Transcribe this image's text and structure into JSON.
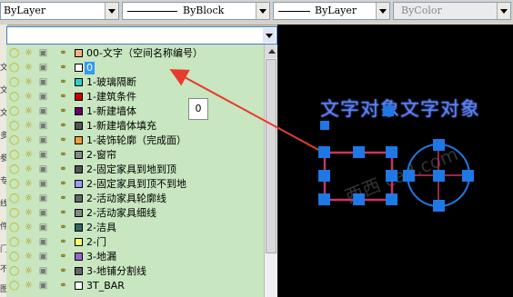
{
  "toolbar": {
    "color_value": "ByLayer",
    "linetype_value": "ByBlock",
    "lineweight_value": "ByLayer",
    "plotstyle_value": "ByColor"
  },
  "layer_combo": {
    "value": ""
  },
  "layer_tools": [
    {
      "icon": "make-current-icon"
    },
    {
      "icon": "layer-previous-icon"
    },
    {
      "icon": "layer-state-icon"
    }
  ],
  "left_strip_chars": [
    "文",
    "文",
    "文",
    "多",
    "参",
    "专",
    "线",
    "件",
    "门",
    "不",
    "图"
  ],
  "layers": [
    {
      "name": "00-文字（空间名称编号）",
      "color": "#f4b183"
    },
    {
      "name": "0",
      "color": "#ffffff",
      "selected": true
    },
    {
      "name": "1-玻璃隔断",
      "color": "#33cccc"
    },
    {
      "name": "1-建筑条件",
      "color": "#cc0000"
    },
    {
      "name": "1-新建墙体",
      "color": "#660066"
    },
    {
      "name": "1-新建墙体填充",
      "color": "#555555"
    },
    {
      "name": "1-装饰轮廓（完成面）",
      "color": "#f0a030"
    },
    {
      "name": "2-窗帘",
      "color": "#888888"
    },
    {
      "name": "2-固定家具到地到顶",
      "color": "#555555"
    },
    {
      "name": "2-固定家具到顶不到地",
      "color": "#9999ff"
    },
    {
      "name": "2-活动家具轮廓线",
      "color": "#666666"
    },
    {
      "name": "2-活动家具细线",
      "color": "#888888"
    },
    {
      "name": "2-洁具",
      "color": "#336666"
    },
    {
      "name": "2-门",
      "color": "#ffff66"
    },
    {
      "name": "3-地漏",
      "color": "#9966cc"
    },
    {
      "name": "3-地铺分割线",
      "color": "#666666"
    },
    {
      "name": "3T_BAR",
      "color": "#ffffff"
    }
  ],
  "tooltip": {
    "text": "0"
  },
  "canvas": {
    "text": "文字对象文字对象",
    "text_color": "#5a82ff",
    "grip_color": "#1e78e6",
    "shape_color": "#cc3366",
    "watermark": "西西 cad.com"
  },
  "annotation_color": "#e83a2e"
}
